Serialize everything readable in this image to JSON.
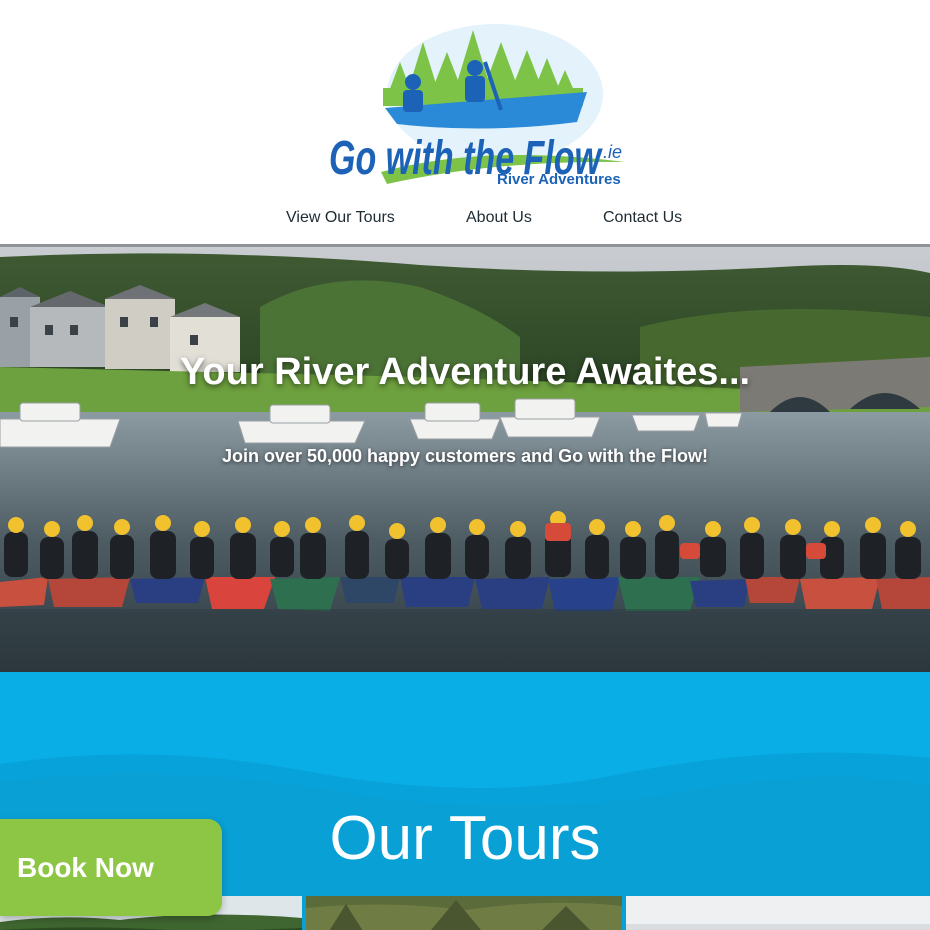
{
  "brand": {
    "logo_text_main": "Go with the Flow",
    "logo_text_tld": ".ie",
    "logo_tagline": "River Adventures"
  },
  "nav": {
    "items": [
      {
        "label": "View Our Tours"
      },
      {
        "label": "About Us"
      },
      {
        "label": "Contact Us"
      }
    ]
  },
  "hero": {
    "title": "Your River Adventure Awaites...",
    "subtitle": "Join over 50,000 happy customers and Go with the Flow!"
  },
  "tours": {
    "heading": "Our Tours"
  },
  "cta": {
    "book_label": "Book Now"
  },
  "colors": {
    "brand_blue": "#0aaee6",
    "brand_green": "#8dc644",
    "logo_blue": "#1c63b7"
  }
}
